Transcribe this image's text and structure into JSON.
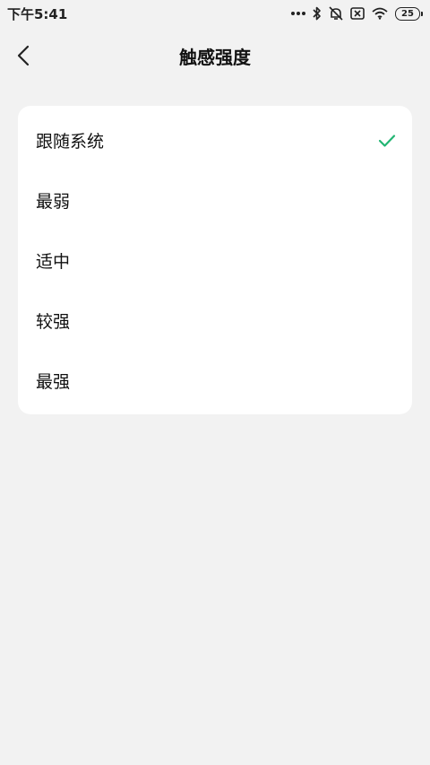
{
  "status_bar": {
    "time": "下午5:41",
    "battery_level": "25",
    "icons": [
      "more-dots-icon",
      "bluetooth-icon",
      "alarm-off-icon",
      "sim-off-icon",
      "wifi-icon",
      "battery-icon"
    ]
  },
  "header": {
    "title": "触感强度",
    "back_icon": "chevron-left-icon"
  },
  "options": [
    {
      "label": "跟随系统",
      "selected": true
    },
    {
      "label": "最弱",
      "selected": false
    },
    {
      "label": "适中",
      "selected": false
    },
    {
      "label": "较强",
      "selected": false
    },
    {
      "label": "最强",
      "selected": false
    }
  ],
  "colors": {
    "background": "#f2f2f2",
    "card": "#ffffff",
    "accent": "#22b573"
  }
}
